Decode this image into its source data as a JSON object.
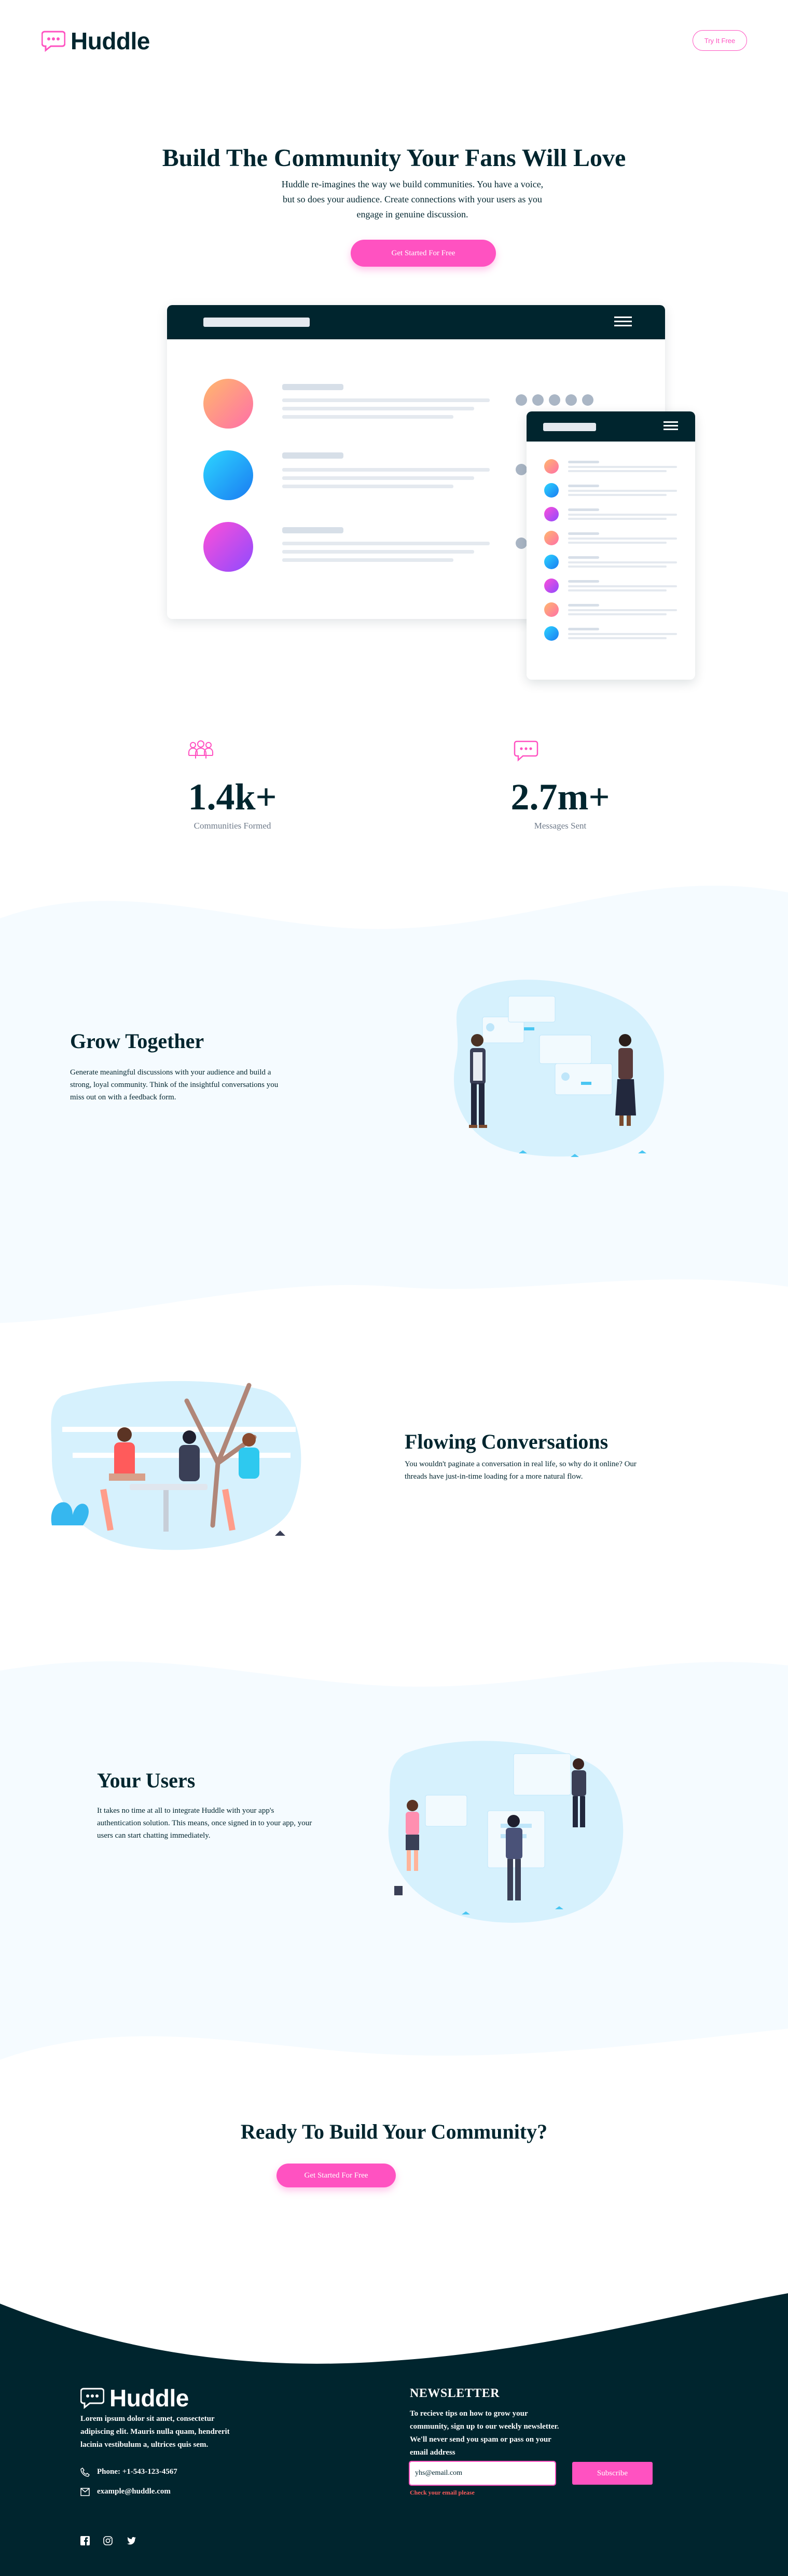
{
  "header": {
    "logo_text": "Huddle",
    "try_button": "Try It Free"
  },
  "hero": {
    "title": "Build The Community Your Fans Will Love",
    "description": "Huddle re-imagines the way we build communities. You have a voice, but so does your audience. Create connections with your users as you engage in genuine discussion.",
    "cta": "Get Started For Free"
  },
  "stats": [
    {
      "value": "1.4k+",
      "label": "Communities Formed",
      "icon": "communities-icon"
    },
    {
      "value": "2.7m+",
      "label": "Messages Sent",
      "icon": "messages-icon"
    }
  ],
  "features": [
    {
      "title": "Grow Together",
      "text": "Generate meaningful discussions with your audience and build a strong, loyal community. Think of the insightful conversations you miss out on with a feedback form."
    },
    {
      "title": "Flowing Conversations",
      "text": "You wouldn't paginate a conversation in real life, so why do it online? Our threads have just-in-time loading for a more natural flow."
    },
    {
      "title": "Your Users",
      "text": "It takes no time at all to integrate Huddle with your app's authentication solution. This means, once signed in to your app, your users can start chatting immediately."
    }
  ],
  "cta_section": {
    "title": "Ready To Build Your Community?",
    "button": "Get Started For Free"
  },
  "footer": {
    "logo_text": "Huddle",
    "about": "Lorem ipsum dolor sit amet, consectetur adipiscing elit. Mauris nulla quam, hendrerit lacinia vestibulum a, ultrices quis sem.",
    "phone": "Phone: +1-543-123-4567",
    "email": "example@huddle.com",
    "newsletter_title": "NEWSLETTER",
    "newsletter_text": "To recieve tips on how to grow your community, sign up to our weekly newsletter. We'll never send you spam or pass on your email address",
    "email_value": "yhs@email.com",
    "subscribe": "Subscribe",
    "error": "Check your email please",
    "social": [
      "facebook-icon",
      "instagram-icon",
      "twitter-icon"
    ]
  },
  "colors": {
    "navy": "#00252e",
    "pink": "#ff52c1",
    "light_bg": "#f5fbff"
  }
}
